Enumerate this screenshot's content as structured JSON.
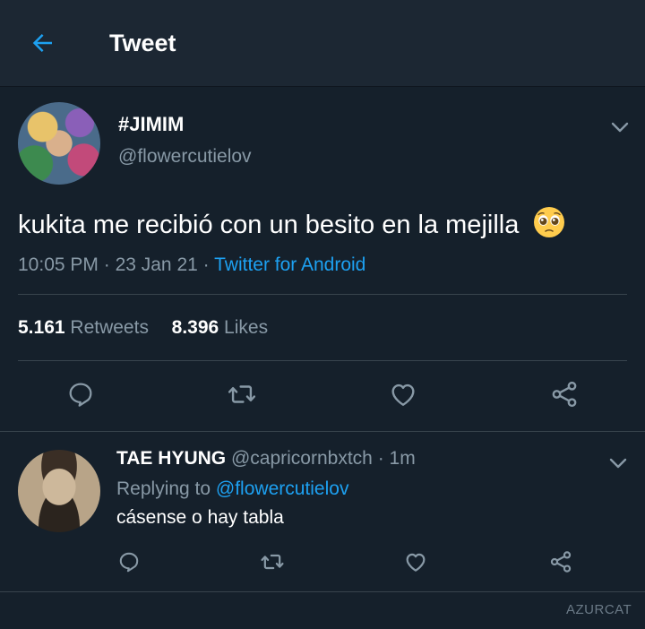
{
  "header": {
    "title": "Tweet",
    "back_icon": "arrow-left-icon",
    "accent_color": "#1da1f2"
  },
  "tweet": {
    "display_name": "#JIMIM",
    "handle": "@flowercutielov",
    "text": "kukita me recibió con un besito en la mejilla",
    "emoji": "pleading-face",
    "time": "10:05 PM",
    "date": "23 Jan 21",
    "source": "Twitter for Android",
    "retweets_count": "5.161",
    "retweets_label": "Retweets",
    "likes_count": "8.396",
    "likes_label": "Likes"
  },
  "reply": {
    "display_name": "TAE HYUNG",
    "handle": "@capricornbxtch",
    "time": "1m",
    "replying_to_label": "Replying to",
    "replying_to_handle": "@flowercutielov",
    "text": "cásense o hay tabla"
  },
  "watermark": "AZURCAT",
  "colors": {
    "background": "#15202b",
    "header_background": "#1c2733",
    "secondary_text": "#8899a6",
    "link": "#1da1f2",
    "divider": "#38444d"
  }
}
